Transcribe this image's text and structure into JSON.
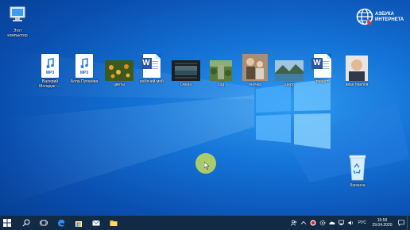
{
  "desktop": {
    "icons": [
      {
        "name": "this-pc",
        "label": "Этот\nкомпьютер"
      },
      {
        "name": "mp3-file-1",
        "label": "Валерий\nМеладзе -...",
        "badge": "MP3"
      },
      {
        "name": "mp3-file-2",
        "label": "Алла Пугачёва",
        "badge": "MP3"
      },
      {
        "name": "photo-flowers",
        "label": "цветы"
      },
      {
        "name": "word-doc-1",
        "label": "рабочий мой"
      },
      {
        "name": "photo-ocean",
        "label": "Океан"
      },
      {
        "name": "photo-garden",
        "label": "сад"
      },
      {
        "name": "photo-family",
        "label": "внучка"
      },
      {
        "name": "photo-lake",
        "label": "озеро"
      },
      {
        "name": "word-doc-2",
        "label": "рецепт"
      },
      {
        "name": "photo-ivan",
        "label": "иван павлов"
      },
      {
        "name": "recycle-bin",
        "label": "Корзина"
      }
    ]
  },
  "logo": {
    "line1": "АЗБУКА",
    "line2": "ИНТЕРНЕТА"
  },
  "taskbar": {
    "language": "РУС",
    "time": "15:59",
    "date": "29.04.2020"
  },
  "colors": {
    "taskbar": "#112a45",
    "wallpaper": "#1473d6",
    "cursor_highlight": "#c6dc5a"
  }
}
